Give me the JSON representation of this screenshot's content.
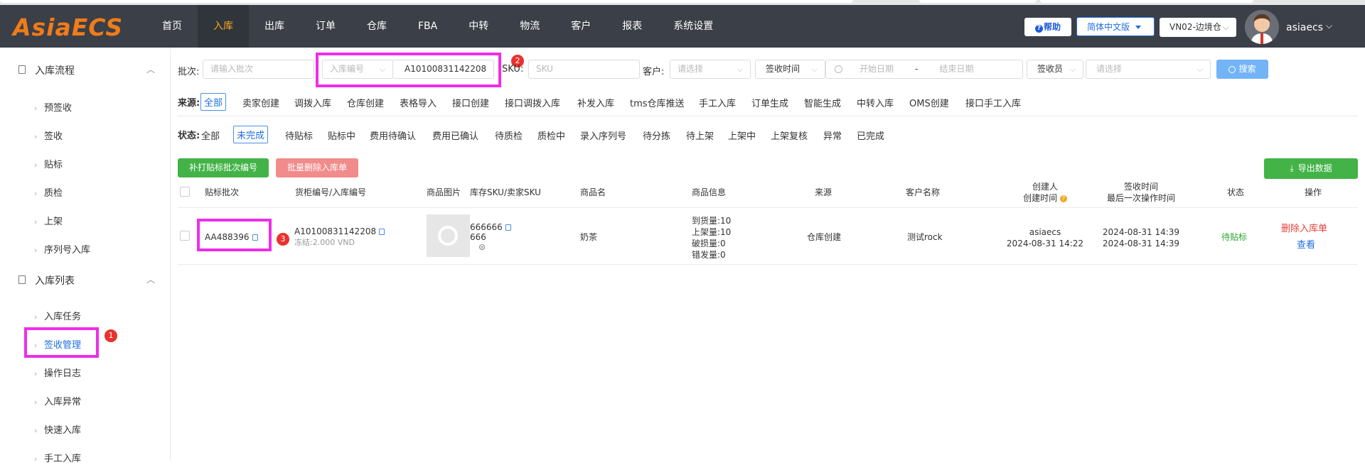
{
  "header": {
    "logo": "AsiaECS",
    "nav": [
      "首页",
      "入库",
      "出库",
      "订单",
      "仓库",
      "FBA",
      "中转",
      "物流",
      "客户",
      "报表",
      "系统设置"
    ],
    "active_nav": "入库",
    "help_label": "帮助",
    "help_icon": "?",
    "language": "简体中文版",
    "warehouse": "VN02-边境仓",
    "username": "asiaecs"
  },
  "sidebar": {
    "group1": "入库流程",
    "group1_items": [
      "预签收",
      "签收",
      "贴标",
      "质检",
      "上架",
      "序列号入库"
    ],
    "group2": "入库列表",
    "group2_items": [
      "入库任务",
      "签收管理",
      "操作日志",
      "入库异常",
      "快速入库",
      "手工入库"
    ],
    "active_item": "签收管理"
  },
  "filters": {
    "batch_label": "批次:",
    "batch_placeholder": "请输入批次",
    "type_select": "入库编号",
    "inbound_no_value": "A10100831142208",
    "sku_label": "SKU:",
    "sku_placeholder": "SKU",
    "customer_label": "客户:",
    "customer_placeholder": "请选择",
    "time_select": "签收时间",
    "start_date_placeholder": "开始日期",
    "date_sep": "-",
    "end_date_placeholder": "结束日期",
    "signer_select": "签收员",
    "signer_placeholder": "请选择",
    "search_label": "搜索"
  },
  "source": {
    "label": "来源:",
    "options": [
      "全部",
      "卖家创建",
      "调拨入库",
      "仓库创建",
      "表格导入",
      "接口创建",
      "接口调拨入库",
      "补发入库",
      "tms仓库推送",
      "手工入库",
      "订单生成",
      "智能生成",
      "中转入库",
      "OMS创建",
      "接口手工入库"
    ],
    "selected": "全部"
  },
  "status": {
    "label": "状态:",
    "options": [
      "全部",
      "未完成",
      "待贴标",
      "贴标中",
      "费用待确认",
      "费用已确认",
      "待质检",
      "质检中",
      "录入序列号",
      "待分拣",
      "待上架",
      "上架中",
      "上架复核",
      "异常",
      "已完成"
    ],
    "selected": "未完成"
  },
  "actions": {
    "reprint": "补打贴标批次编号",
    "batch_delete": "批量删除入库单",
    "export": "导出数据"
  },
  "table": {
    "headers": {
      "batch": "贴标批次",
      "container": "货柜编号/入库编号",
      "image": "商品图片",
      "sku": "库存SKU/卖家SKU",
      "name": "商品名",
      "info": "商品信息",
      "source": "来源",
      "customer": "客户名称",
      "creator": "创建人",
      "create_time": "创建时间",
      "sign_time": "签收时间",
      "last_op": "最后一次操作时间",
      "status": "状态",
      "ops": "操作"
    },
    "rows": [
      {
        "batch": "AA488396",
        "inbound_no": "A10100831142208",
        "frozen": "冻结:2.000 VND",
        "sku": "666666",
        "seller_sku": "666",
        "name": "奶茶",
        "info": [
          "到货量:10",
          "上架量:10",
          "破损量:0",
          "错发量:0"
        ],
        "source": "仓库创建",
        "customer": "测试rock",
        "creator": "asiaecs",
        "create_time": "2024-08-31 14:22",
        "sign_time": "2024-08-31 14:39",
        "last_op_time": "2024-08-31 14:39",
        "status": "待贴标",
        "op_delete": "删除入库单",
        "op_view": "查看"
      }
    ]
  },
  "badges": [
    "1",
    "2",
    "3"
  ],
  "colors": {
    "accent": "#1f6fe0",
    "highlight": "#ee2ee8",
    "topbar": "#3b3f47",
    "logo": "#f07c1a",
    "nav_active": "#f5a623",
    "green": "#43b348",
    "badge": "#e8322e"
  }
}
